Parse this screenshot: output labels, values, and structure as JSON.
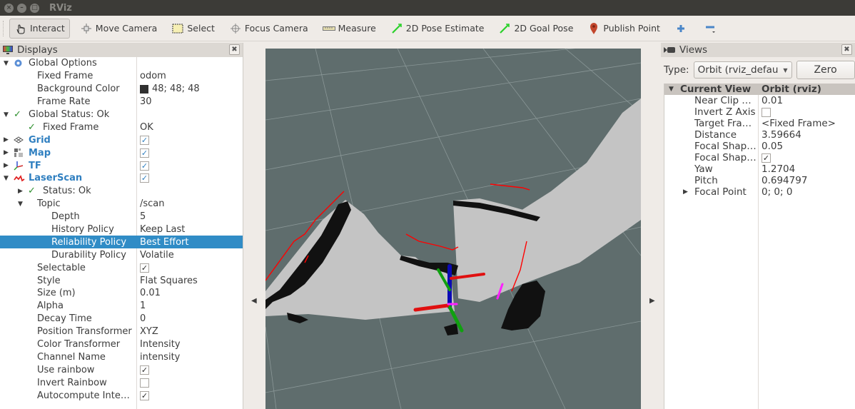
{
  "window": {
    "title": "RViz",
    "buttons": [
      "close",
      "minimize",
      "maximize"
    ]
  },
  "toolbar": {
    "tools": [
      {
        "label": "Interact",
        "icon": "hand-pointer-icon",
        "active": true
      },
      {
        "label": "Move Camera",
        "icon": "move-camera-icon",
        "active": false
      },
      {
        "label": "Select",
        "icon": "select-rectangle-icon",
        "active": false
      },
      {
        "label": "Focus Camera",
        "icon": "focus-camera-icon",
        "active": false
      },
      {
        "label": "Measure",
        "icon": "ruler-icon",
        "active": false
      },
      {
        "label": "2D Pose Estimate",
        "icon": "green-arrow-icon",
        "active": false
      },
      {
        "label": "2D Goal Pose",
        "icon": "green-arrow-icon",
        "active": false
      },
      {
        "label": "Publish Point",
        "icon": "map-pin-icon",
        "active": false
      }
    ],
    "add_tool": "plus-icon",
    "remove_tool": "minus-icon"
  },
  "displays": {
    "title": "Displays",
    "rows": [
      {
        "indent": 0,
        "arrow": "down",
        "icon": "gear-icon",
        "label": "Global Options",
        "value": ""
      },
      {
        "indent": 1,
        "label": "Fixed Frame",
        "value": "odom"
      },
      {
        "indent": 1,
        "label": "Background Color",
        "value": "48; 48; 48",
        "swatch": "#303030"
      },
      {
        "indent": 1,
        "label": "Frame Rate",
        "value": "30"
      },
      {
        "indent": 0,
        "arrow": "down",
        "icon": "check-icon",
        "label": "Global Status: Ok",
        "value": ""
      },
      {
        "indent": 1,
        "icon": "check-icon",
        "label": "Fixed Frame",
        "value": "OK"
      },
      {
        "indent": 0,
        "arrow": "right",
        "icon": "grid-icon",
        "label": "Grid",
        "value": "",
        "checkbox": true,
        "blue": true
      },
      {
        "indent": 0,
        "arrow": "right",
        "icon": "map-icon",
        "label": "Map",
        "value": "",
        "checkbox": true,
        "blue": true
      },
      {
        "indent": 0,
        "arrow": "right",
        "icon": "tf-axes-icon",
        "label": "TF",
        "value": "",
        "checkbox": true,
        "blue": true
      },
      {
        "indent": 0,
        "arrow": "down",
        "icon": "laserscan-icon",
        "label": "LaserScan",
        "value": "",
        "checkbox": true,
        "blue": true
      },
      {
        "indent": 1,
        "arrow": "right",
        "icon": "check-icon",
        "label": "Status: Ok",
        "value": ""
      },
      {
        "indent": 1,
        "arrow": "down",
        "label": "Topic",
        "value": "/scan"
      },
      {
        "indent": 2,
        "label": "Depth",
        "value": "5"
      },
      {
        "indent": 2,
        "label": "History Policy",
        "value": "Keep Last"
      },
      {
        "indent": 2,
        "label": "Reliability Policy",
        "value": "Best Effort",
        "selected": true
      },
      {
        "indent": 2,
        "label": "Durability Policy",
        "value": "Volatile"
      },
      {
        "indent": 1,
        "label": "Selectable",
        "value": "",
        "checkbox": true
      },
      {
        "indent": 1,
        "label": "Style",
        "value": "Flat Squares"
      },
      {
        "indent": 1,
        "label": "Size (m)",
        "value": "0.01"
      },
      {
        "indent": 1,
        "label": "Alpha",
        "value": "1"
      },
      {
        "indent": 1,
        "label": "Decay Time",
        "value": "0"
      },
      {
        "indent": 1,
        "label": "Position Transformer",
        "value": "XYZ"
      },
      {
        "indent": 1,
        "label": "Color Transformer",
        "value": "Intensity"
      },
      {
        "indent": 1,
        "label": "Channel Name",
        "value": "intensity"
      },
      {
        "indent": 1,
        "label": "Use rainbow",
        "value": "",
        "checkbox": true
      },
      {
        "indent": 1,
        "label": "Invert Rainbow",
        "value": "",
        "checkbox": false
      },
      {
        "indent": 1,
        "label": "Autocompute Inte…",
        "value": "",
        "checkbox": true
      }
    ]
  },
  "views": {
    "title": "Views",
    "type_label": "Type:",
    "type_value": "Orbit (rviz_defau",
    "zero_label": "Zero",
    "header": {
      "label": "Current View",
      "value": "Orbit (rviz)"
    },
    "rows": [
      {
        "label": "Near Clip …",
        "value": "0.01"
      },
      {
        "label": "Invert Z Axis",
        "value": "",
        "checkbox": false
      },
      {
        "label": "Target Fra…",
        "value": "<Fixed Frame>"
      },
      {
        "label": "Distance",
        "value": "3.59664"
      },
      {
        "label": "Focal Shap…",
        "value": "0.05"
      },
      {
        "label": "Focal Shap…",
        "value": "",
        "checkbox": true
      },
      {
        "label": "Yaw",
        "value": "1.2704"
      },
      {
        "label": "Pitch",
        "value": "0.694797"
      },
      {
        "label": "Focal Point",
        "value": "0; 0; 0",
        "arrow": "right"
      }
    ]
  },
  "viewport": {
    "background": "#5f6d6d",
    "free_space": "#c4c4c4",
    "occupied": "#111111",
    "scan_color": "#ff0000",
    "axis_colors": {
      "x": "#e01010",
      "y": "#10a010",
      "z": "#0a0ab4"
    }
  }
}
